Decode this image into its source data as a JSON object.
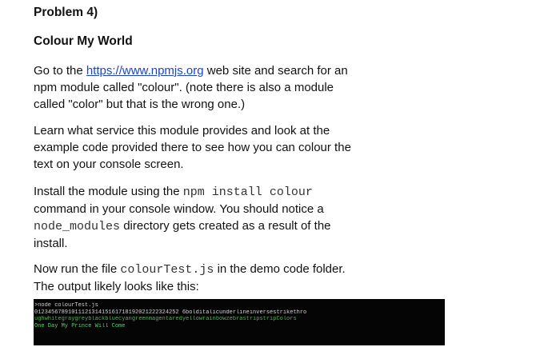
{
  "document": {
    "problem_heading": "Problem 4)",
    "section_title": "Colour My World",
    "para1": {
      "line1_before": "Go to the ",
      "link_text": "https://www.npmjs.org",
      "line1_after": " web site and search for an",
      "line2": "npm module called \"colour\". (note there is also a module",
      "line3": "called \"color\" but that is the wrong one.)"
    },
    "para2": {
      "line1": "Learn what service this module provides and look at the",
      "line2": "example code provided there to see how you can colour the",
      "line3": "text on your console screen."
    },
    "para3": {
      "line1_text": "Install the module using the ",
      "line1_code": "npm install colour",
      "line2": "command in your console window. You should notice a",
      "line3_code": "node_modules",
      "line3_text": " directory gets created as a result of the",
      "line4": "install."
    },
    "para4": {
      "line1_text": "Now run the file ",
      "line1_code": "colourTest.js",
      "line1_after": " in the demo code folder.",
      "line2": "The output likely looks like this:"
    }
  },
  "console": {
    "prompt_line": ">node colourTest.js",
    "numbers_line": "0123456789101112131415161718192021222324252 6bolditalicunderlineinversestrikethro",
    "words_line": "ughwhitegraygreyblackbluecyangreenmagentaredyellowrainbowzebrastripstripColors",
    "blank_line": " ",
    "last_line": "One Day My Prince Will Come"
  },
  "colors": {
    "link": "#1a44d6",
    "console_background": "#050505",
    "console_green": "#5fcf6f"
  }
}
